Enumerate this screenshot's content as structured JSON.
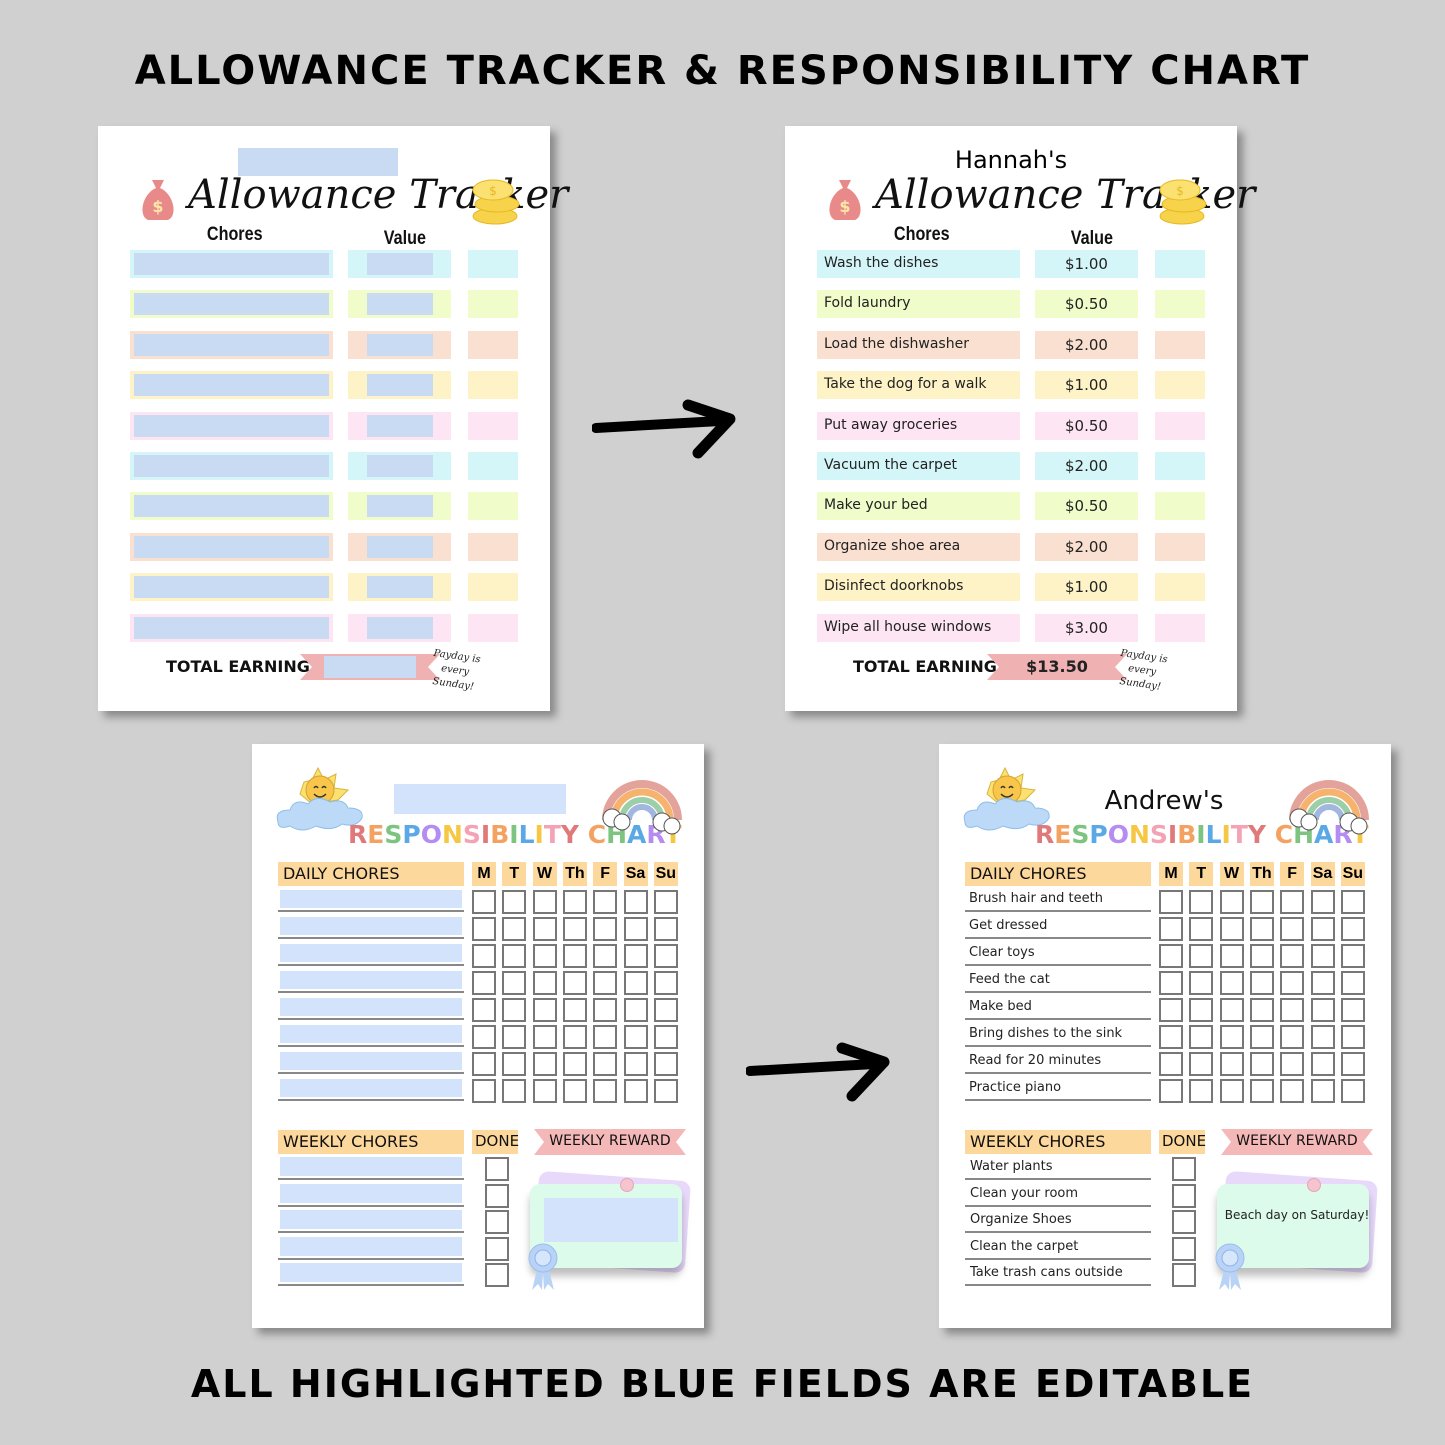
{
  "header_text": "ALLOWANCE TRACKER & RESPONSIBILITY CHART",
  "footer_text": "ALL HIGHLIGHTED BLUE FIELDS ARE EDITABLE",
  "colors": {
    "background": "#d0d0d0",
    "editable_blue": "#c9daf3",
    "editable_blue_light": "#d3e3fb",
    "row_colors": [
      "#d5f6f8",
      "#f0fdca",
      "#f9e0d0",
      "#fef3c7",
      "#fde5f3"
    ],
    "header_orange": "#fdd89d",
    "ribbon_pink": "#efb1b1"
  },
  "allowance_blank": {
    "title": "Allowance Tracker",
    "chores_header": "Chores",
    "value_header": "Value",
    "row_count": 10,
    "total_label": "TOTAL EARNINGS:",
    "payday_note": "Payday is every Sunday!"
  },
  "allowance_filled": {
    "name": "Hannah's",
    "title": "Allowance Tracker",
    "chores_header": "Chores",
    "value_header": "Value",
    "rows": [
      {
        "chore": "Wash the dishes",
        "value": "$1.00"
      },
      {
        "chore": "Fold laundry",
        "value": "$0.50"
      },
      {
        "chore": "Load the dishwasher",
        "value": "$2.00"
      },
      {
        "chore": "Take the dog for a walk",
        "value": "$1.00"
      },
      {
        "chore": "Put away groceries",
        "value": "$0.50"
      },
      {
        "chore": "Vacuum the carpet",
        "value": "$2.00"
      },
      {
        "chore": "Make your bed",
        "value": "$0.50"
      },
      {
        "chore": "Organize shoe area",
        "value": "$2.00"
      },
      {
        "chore": "Disinfect doorknobs",
        "value": "$1.00"
      },
      {
        "chore": "Wipe all house windows",
        "value": "$3.00"
      }
    ],
    "total_label": "TOTAL EARNINGS:",
    "total_value": "$13.50",
    "payday_note": "Payday is every Sunday!"
  },
  "responsibility_blank": {
    "title": "RESPONSIBILITY CHART",
    "daily_header": "DAILY CHORES",
    "days": [
      "M",
      "T",
      "W",
      "Th",
      "F",
      "Sa",
      "Su"
    ],
    "daily_row_count": 8,
    "weekly_header": "WEEKLY CHORES",
    "done_header": "DONE",
    "reward_header": "WEEKLY REWARD",
    "weekly_row_count": 5
  },
  "responsibility_filled": {
    "name": "Andrew's",
    "title": "RESPONSIBILITY CHART",
    "daily_header": "DAILY CHORES",
    "days": [
      "M",
      "T",
      "W",
      "Th",
      "F",
      "Sa",
      "Su"
    ],
    "daily_chores": [
      "Brush hair and teeth",
      "Get dressed",
      "Clear toys",
      "Feed the cat",
      "Make bed",
      "Bring dishes to the sink",
      "Read for 20 minutes",
      "Practice piano"
    ],
    "weekly_header": "WEEKLY CHORES",
    "done_header": "DONE",
    "reward_header": "WEEKLY REWARD",
    "weekly_chores": [
      "Water plants",
      "Clean your room",
      "Organize Shoes",
      "Clean the carpet",
      "Take trash cans outside"
    ],
    "reward": "Beach day on Saturday!"
  },
  "title_letter_colors": [
    "#e07a7a",
    "#f4a261",
    "#7cc47f",
    "#5aa9e6",
    "#b48cf2",
    "#f6c744",
    "#f4a3b5",
    "#e07a7a",
    "#f4a261",
    "#7cc47f",
    "#5aa9e6",
    "#f6c744",
    "#f4a3b5",
    "#e07a7a",
    "#f4a261",
    "#7cc47f",
    "#5aa9e6",
    "#b48cf2",
    "#f6c744"
  ]
}
